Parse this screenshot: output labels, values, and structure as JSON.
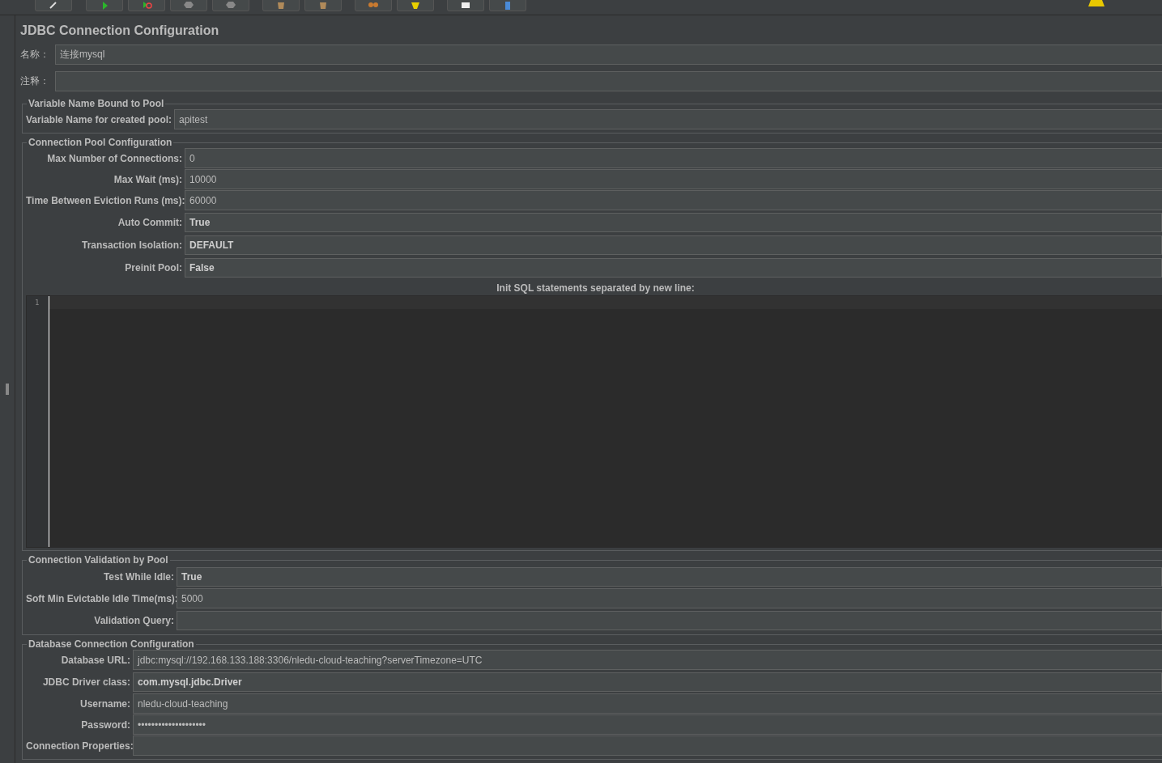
{
  "panel": {
    "title": "JDBC Connection Configuration",
    "name": {
      "label": "名称：",
      "value": "连接mysql"
    },
    "comment": {
      "label": "注释："
    }
  },
  "sections": [
    {
      "title": "Variable Name Bound to Pool",
      "fields": [
        {
          "label": "Variable Name for created pool:",
          "value": "apitest",
          "kind": "text"
        }
      ]
    },
    {
      "title": "Connection Pool Configuration",
      "fields": [
        {
          "label": "Max Number of Connections:",
          "value": "0",
          "kind": "text"
        },
        {
          "label": "Max Wait (ms):",
          "value": "10000",
          "kind": "text"
        },
        {
          "label": "Time Between Eviction Runs (ms):",
          "value": "60000",
          "kind": "text"
        },
        {
          "label": "Auto Commit:",
          "value": "True",
          "kind": "combo"
        },
        {
          "label": "Transaction Isolation:",
          "value": "DEFAULT",
          "kind": "combo"
        },
        {
          "label": "Preinit Pool:",
          "value": "False",
          "kind": "combo"
        }
      ],
      "editor": {
        "label": "Init SQL statements separated by new line:",
        "line_numbers": [
          "1"
        ]
      }
    },
    {
      "title": "Connection Validation by Pool",
      "fields": [
        {
          "label": "Test While Idle:",
          "value": "True",
          "kind": "combo"
        },
        {
          "label": "Soft Min Evictable Idle Time(ms):",
          "value": "5000",
          "kind": "text"
        },
        {
          "label": "Validation Query:",
          "kind": "combo"
        }
      ]
    },
    {
      "title": "Database Connection Configuration",
      "fields": [
        {
          "label": "Database URL:",
          "value": "jdbc:mysql://192.168.133.188:3306/nledu-cloud-teaching?serverTimezone=UTC",
          "kind": "text"
        },
        {
          "label": "JDBC Driver class:",
          "value": "com.mysql.jdbc.Driver",
          "kind": "combo"
        },
        {
          "label": "Username:",
          "value": "nledu-cloud-teaching",
          "kind": "text"
        },
        {
          "label": "Password:",
          "value": "••••••••••••••••••••",
          "kind": "text"
        },
        {
          "label": "Connection Properties:",
          "kind": "text"
        }
      ]
    }
  ]
}
